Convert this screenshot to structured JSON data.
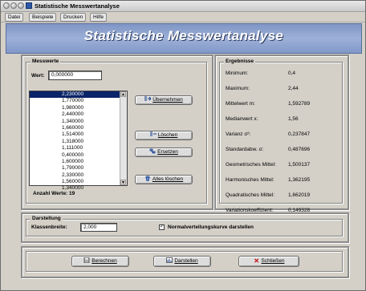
{
  "window": {
    "title": "Statistische Messwertanalyse"
  },
  "menu": {
    "items": [
      "Datei",
      "Beispiele",
      "Drucken",
      "Hilfe"
    ]
  },
  "banner": {
    "heading": "Statistische Messwertanalyse"
  },
  "messwerte": {
    "label": "Messwerte",
    "wert_label": "Wert:",
    "wert_value": "0,000000",
    "list": [
      "2,230000",
      "1,770000",
      "1,980000",
      "2,440000",
      "1,340000",
      "1,660000",
      "1,514000",
      "1,318000",
      "1,111000",
      "0,400000",
      "1,600000",
      "1,790000",
      "2,330000",
      "1,560000",
      "1,340000"
    ],
    "selected_index": 0,
    "count_text": "Anzahl Werte: 19",
    "buttons": {
      "uebernehmen": "Übernehmen",
      "loeschen": "Löschen",
      "ersetzen": "Ersetzen",
      "alles_loeschen": "Alles löschen"
    }
  },
  "ergebnisse": {
    "label": "Ergebnisse",
    "rows": [
      {
        "label": "Minimum:",
        "value": "0,4"
      },
      {
        "label": "Maximum:",
        "value": "2,44"
      },
      {
        "label": "Mittelwert m:",
        "value": "1,592789"
      },
      {
        "label": "Medianwert x:",
        "value": "1,56"
      },
      {
        "label": "Varianz σ²:",
        "value": "0,237847"
      },
      {
        "label": "Standardabw. σ:",
        "value": "0,487696"
      },
      {
        "label": "Geometrisches Mittel:",
        "value": "1,500137"
      },
      {
        "label": "Harmonisches Mittel:",
        "value": "1,362195"
      },
      {
        "label": "Quadratisches Mittel:",
        "value": "1,662019"
      },
      {
        "label": "Variationskoeffizient:",
        "value": "0,149328"
      }
    ]
  },
  "darstellung": {
    "label": "Darstellung",
    "klassenbreite_label": "Klassenbreite:",
    "klassenbreite_value": "2,000",
    "checkbox_label": "Normalverteilungskurve darstellen",
    "checkbox_checked": true
  },
  "actions": {
    "berechnen": "Berechnen",
    "darstellen": "Darstellen",
    "schliessen": "Schließen"
  }
}
